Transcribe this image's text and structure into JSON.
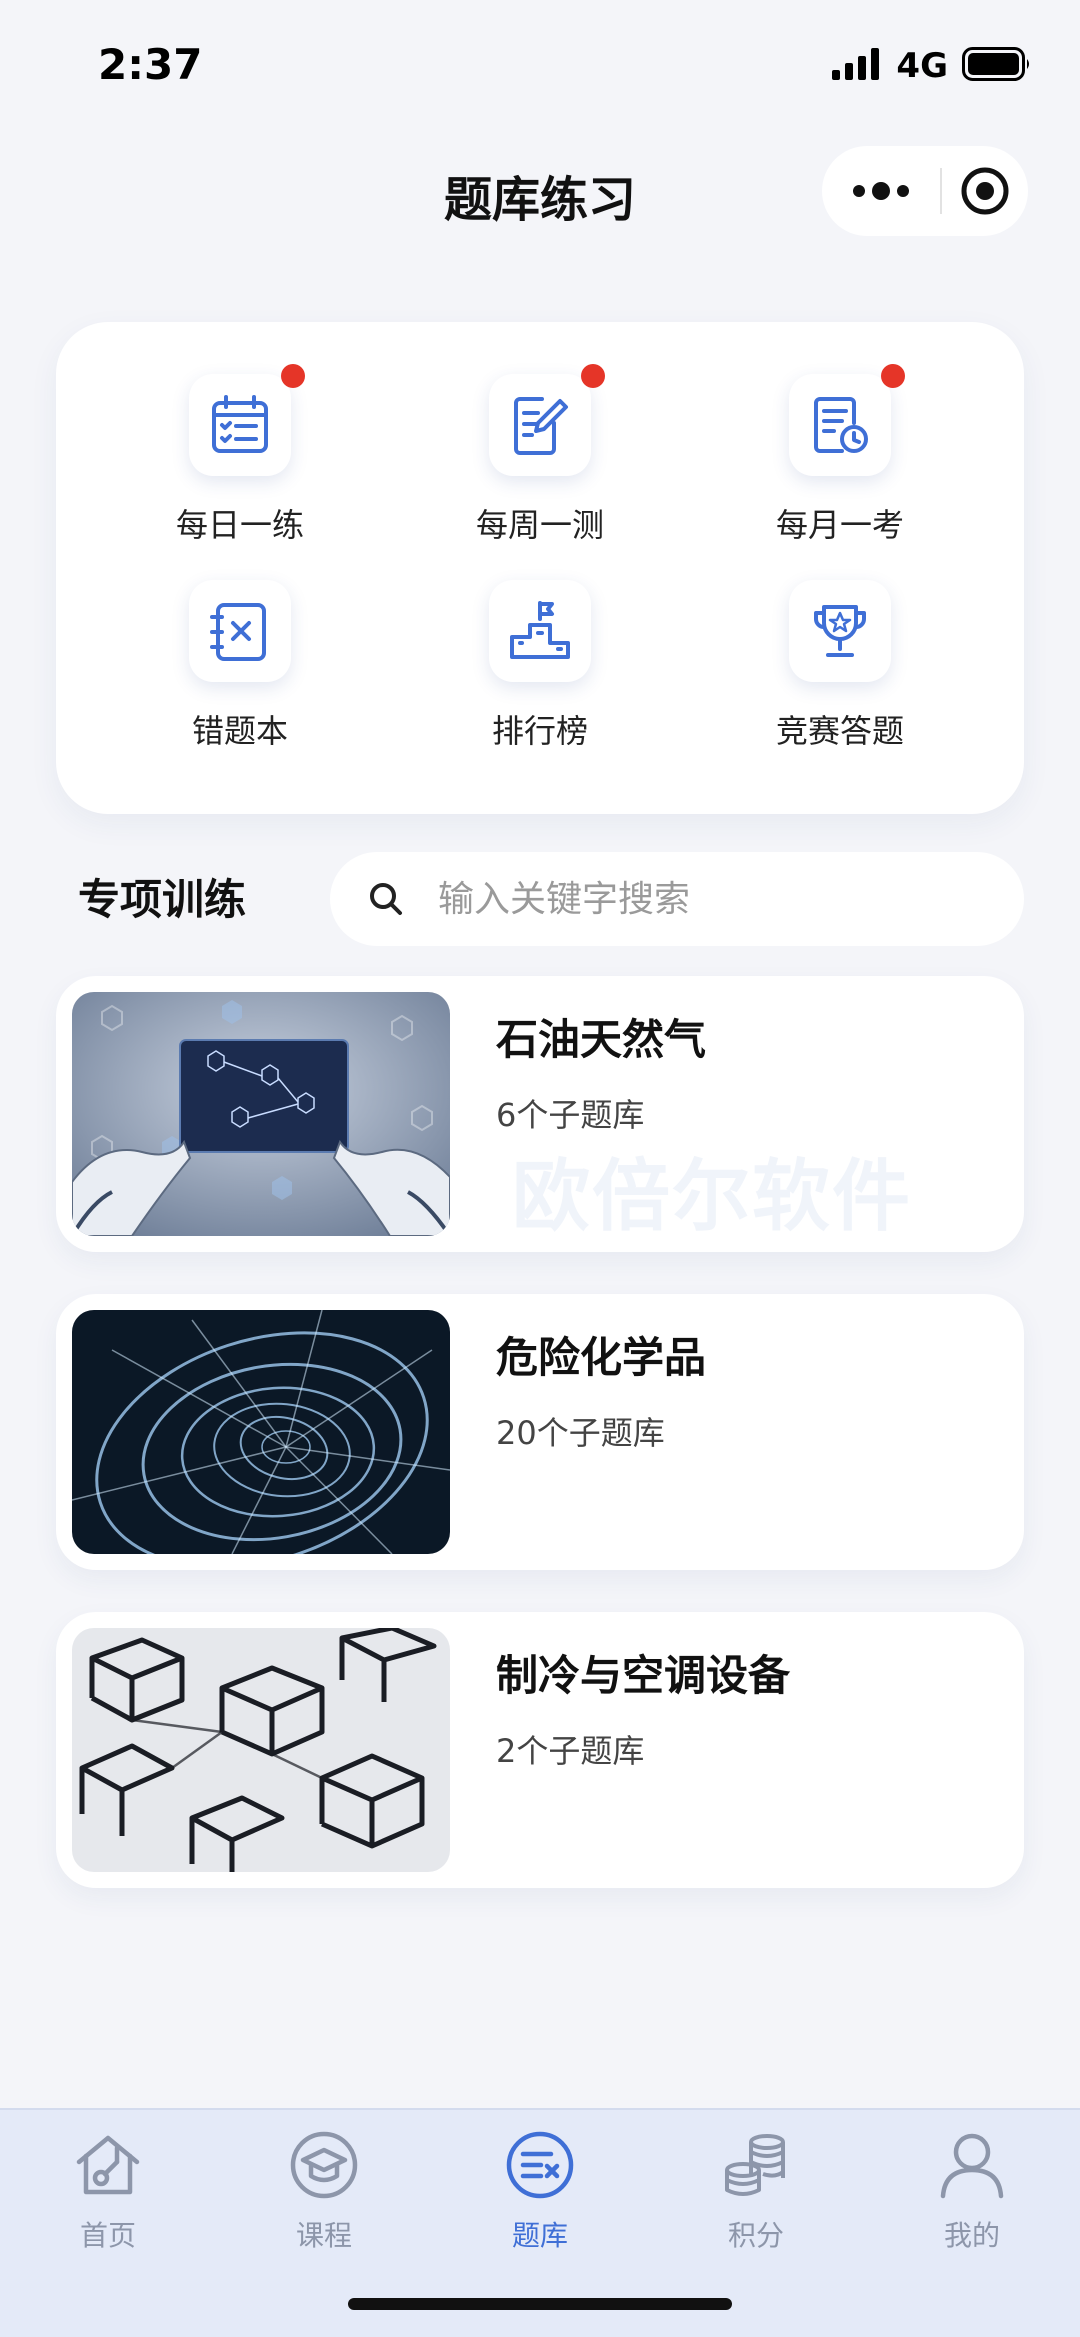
{
  "status_bar": {
    "time": "2:37",
    "network": "4G"
  },
  "nav": {
    "title": "题库练习"
  },
  "quick_actions": [
    {
      "label": "每日一练",
      "icon": "calendar-checklist-icon",
      "badge": true
    },
    {
      "label": "每周一测",
      "icon": "edit-document-icon",
      "badge": true
    },
    {
      "label": "每月一考",
      "icon": "document-clock-icon",
      "badge": true
    },
    {
      "label": "错题本",
      "icon": "wrong-questions-icon",
      "badge": false
    },
    {
      "label": "排行榜",
      "icon": "podium-icon",
      "badge": false
    },
    {
      "label": "竞赛答题",
      "icon": "trophy-icon",
      "badge": false
    }
  ],
  "section": {
    "title": "专项训练",
    "search_placeholder": "输入关键字搜索"
  },
  "topics": [
    {
      "name": "石油天然气",
      "count": "6个子题库",
      "image": "robot-hands-molecule-tablet"
    },
    {
      "name": "危险化学品",
      "count": "20个子题库",
      "image": "blue-spiral-wireframe"
    },
    {
      "name": "制冷与空调设备",
      "count": "2个子题库",
      "image": "wireframe-cubes"
    }
  ],
  "watermark": "欧倍尔软件",
  "tabs": [
    {
      "label": "首页",
      "icon": "home-icon",
      "active": false
    },
    {
      "label": "课程",
      "icon": "graduation-cap-icon",
      "active": false
    },
    {
      "label": "题库",
      "icon": "question-bank-icon",
      "active": true
    },
    {
      "label": "积分",
      "icon": "coins-stack-icon",
      "active": false
    },
    {
      "label": "我的",
      "icon": "user-icon",
      "active": false
    }
  ],
  "colors": {
    "accent": "#3f6fd6",
    "badge": "#e53528",
    "tab_inactive": "#8d96aa",
    "tab_bar_bg": "#e4eaf8"
  }
}
